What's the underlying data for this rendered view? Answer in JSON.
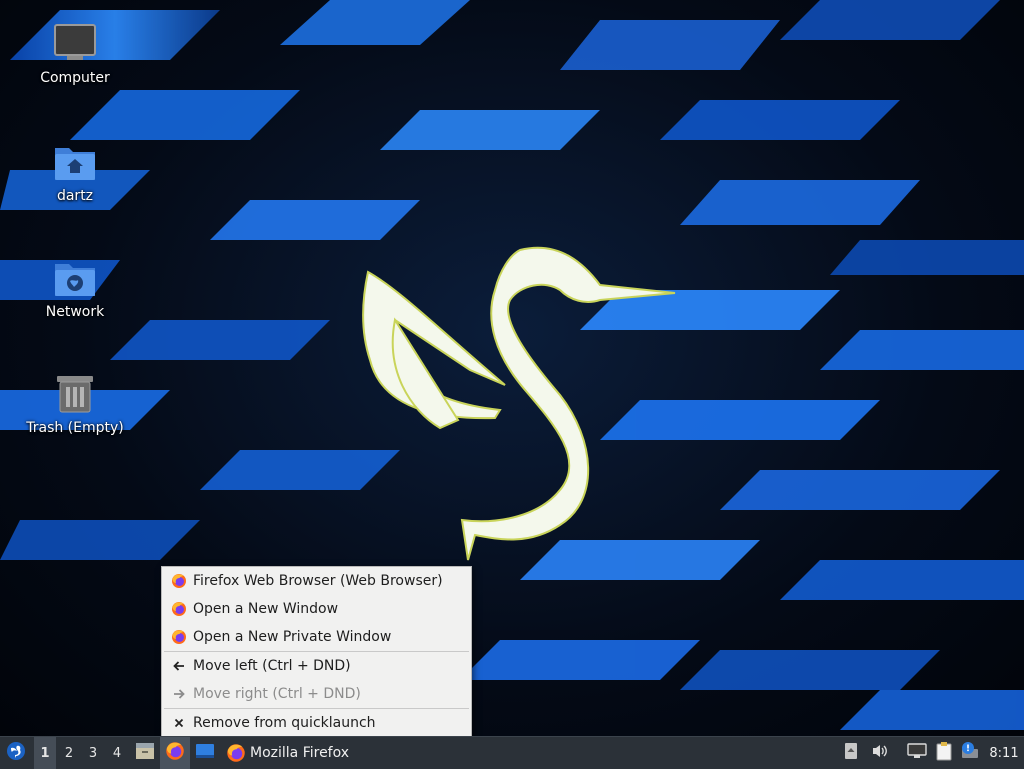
{
  "desktop": {
    "icons": [
      {
        "label": "Computer",
        "icon": "computer-icon"
      },
      {
        "label": "dartz",
        "icon": "home-folder-icon"
      },
      {
        "label": "Network",
        "icon": "network-folder-icon"
      },
      {
        "label": "Trash (Empty)",
        "icon": "trash-icon"
      }
    ]
  },
  "context_menu": {
    "items": [
      {
        "label": "Firefox Web Browser (Web Browser)",
        "icon": "firefox-icon",
        "enabled": true
      },
      {
        "label": "Open a New Window",
        "icon": "firefox-icon",
        "enabled": true
      },
      {
        "label": "Open a New Private Window",
        "icon": "firefox-icon",
        "enabled": true
      },
      {
        "label": "Move left (Ctrl + DND)",
        "icon": "arrow-left-icon",
        "enabled": true
      },
      {
        "label": "Move right (Ctrl + DND)",
        "icon": "arrow-right-icon",
        "enabled": false
      },
      {
        "label": "Remove from quicklaunch",
        "icon": "close-icon",
        "enabled": true
      }
    ]
  },
  "taskbar": {
    "workspaces": [
      "1",
      "2",
      "3",
      "4"
    ],
    "active_workspace": "1",
    "task_label": "Mozilla Firefox",
    "clock": "8:11"
  },
  "colors": {
    "taskbar_bg": "#2b3138",
    "menu_bg": "#f1f1f0",
    "accent_blue": "#2a7de1"
  }
}
